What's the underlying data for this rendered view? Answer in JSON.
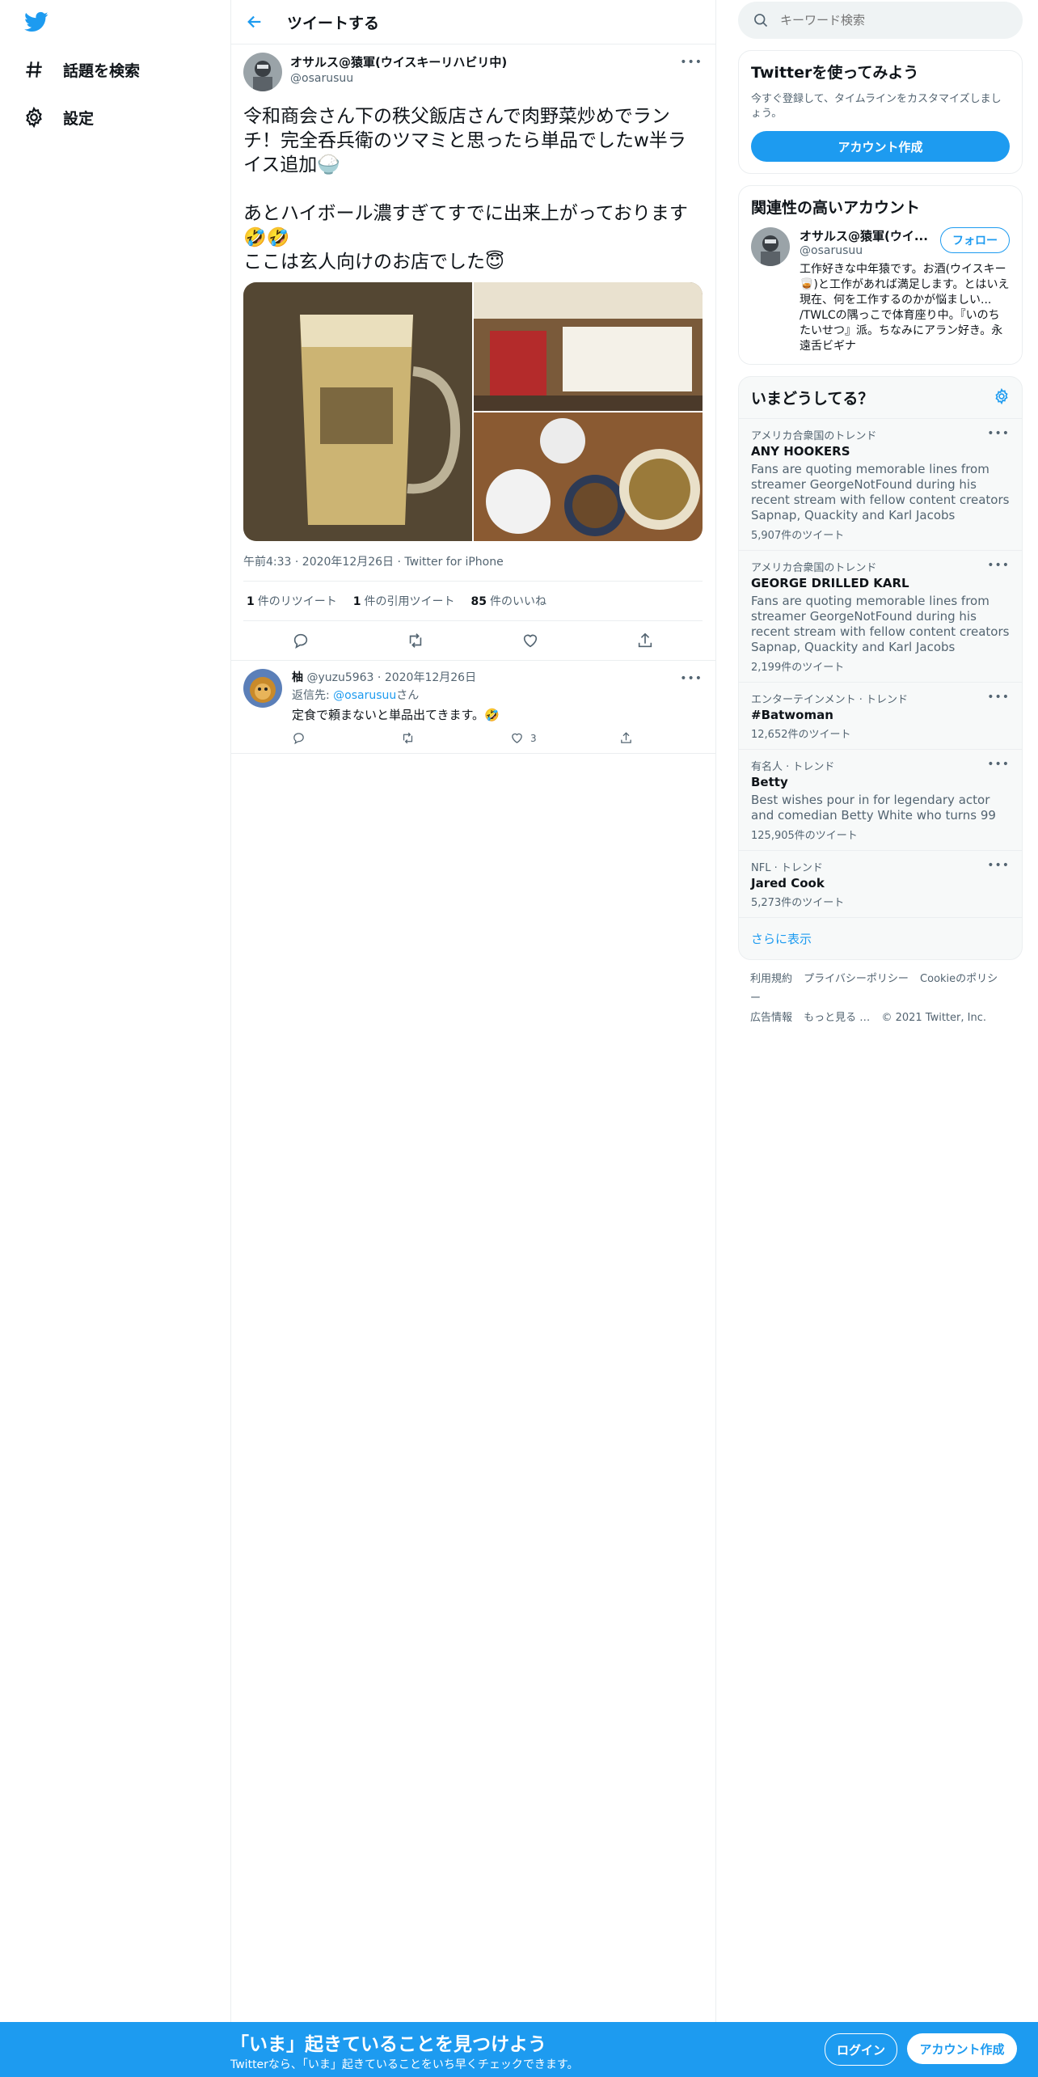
{
  "nav": {
    "logo_icon": "twitter-bird-icon",
    "items": [
      {
        "label": "話題を検索",
        "icon": "hashtag-icon"
      },
      {
        "label": "設定",
        "icon": "gear-icon"
      }
    ]
  },
  "header": {
    "title": "ツイートする",
    "back_icon": "arrow-left-icon"
  },
  "tweet": {
    "name": "オサルス@猿軍(ウイスキーリハビリ中)",
    "handle": "@osarusuu",
    "text": "令和商会さん下の秩父飯店さんで肉野菜炒めでランチ！完全呑兵衛のツマミと思ったら単品でしたw半ライス追加🍚\n\nあとハイボール濃すぎてすでに出来上がっております🤣🤣\nここは玄人向けのお店でした😇",
    "meta": "午前4:33 · 2020年12月26日 · Twitter for iPhone",
    "stats": [
      {
        "count": "1",
        "label": "件のリツイート"
      },
      {
        "count": "1",
        "label": "件の引用ツイート"
      },
      {
        "count": "85",
        "label": "件のいいね"
      }
    ]
  },
  "reply": {
    "name": "柚",
    "handle": "@yuzu5963",
    "date": "2020年12月26日",
    "reply_prefix": "返信先: ",
    "reply_to": "@osarusuu",
    "reply_suffix": "さん",
    "text": "定食で頼まないと単品出てきます。🤣",
    "like_count": "3"
  },
  "right": {
    "search_placeholder": "キーワード検索",
    "signup_card": {
      "title": "Twitterを使ってみよう",
      "subtitle": "今すぐ登録して、タイムラインをカスタマイズしましょう。",
      "button": "アカウント作成"
    },
    "relevant": {
      "title": "関連性の高いアカウント",
      "name": "オサルス@猿軍(ウイ...",
      "handle": "@osarusuu",
      "follow": "フォロー",
      "bio": "工作好きな中年猿です。お酒(ウイスキー🥃)と工作があれば満足します。とはいえ現在、何を工作するのかが悩ましい... /TWLCの隅っこで体育座り中。『いのちたいせつ』派。ちなみにアラン好き。永遠舌ビギナ"
    },
    "trends": {
      "title": "いまどうしてる？",
      "items": [
        {
          "context": "アメリカ合衆国のトレンド",
          "name": "ANY HOOKERS",
          "desc": "Fans are quoting memorable lines from streamer GeorgeNotFound during his recent stream with fellow content creators Sapnap, Quackity and Karl Jacobs",
          "count": "5,907件のツイート"
        },
        {
          "context": "アメリカ合衆国のトレンド",
          "name": "GEORGE DRILLED KARL",
          "desc": "Fans are quoting memorable lines from streamer GeorgeNotFound during his recent stream with fellow content creators Sapnap, Quackity and Karl Jacobs",
          "count": "2,199件のツイート"
        },
        {
          "context": "エンターテインメント · トレンド",
          "name": "#Batwoman",
          "desc": "",
          "count": "12,652件のツイート"
        },
        {
          "context": "有名人 · トレンド",
          "name": "Betty",
          "desc": "Best wishes pour in for legendary actor and comedian Betty White who turns 99",
          "count": "125,905件のツイート"
        },
        {
          "context": "NFL · トレンド",
          "name": "Jared Cook",
          "desc": "",
          "count": "5,273件のツイート"
        }
      ],
      "show_more": "さらに表示"
    },
    "footer": [
      "利用規約",
      "プライバシーポリシー",
      "Cookieのポリシー",
      "広告情報",
      "もっと見る …",
      "© 2021 Twitter, Inc."
    ]
  },
  "banner": {
    "title": "「いま」起きていることを見つけよう",
    "subtitle": "Twitterなら、「いま」起きていることをいち早くチェックできます。",
    "login": "ログイン",
    "signup": "アカウント作成"
  },
  "colors": {
    "accent": "#1d9bf0",
    "text": "#0f1419",
    "muted": "#536471",
    "border": "#ebeef0"
  }
}
